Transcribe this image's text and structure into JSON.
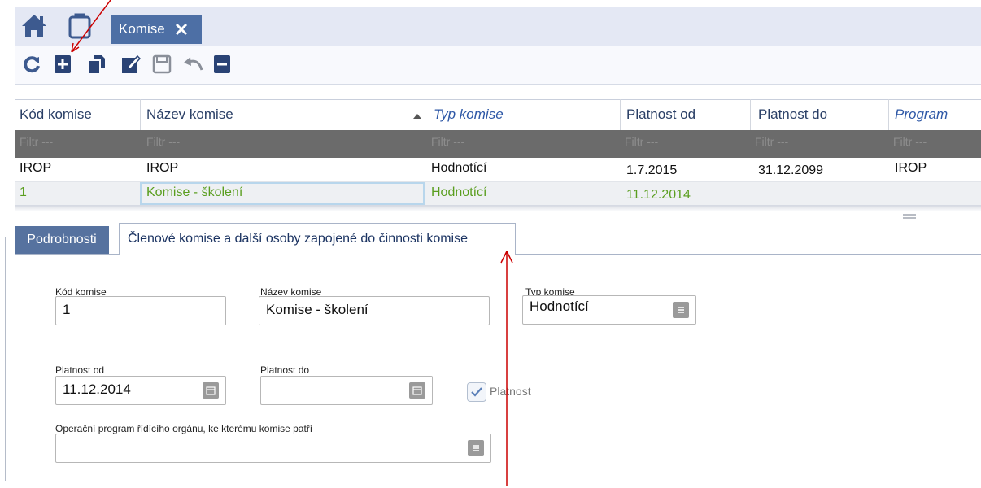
{
  "top_tab": {
    "label": "Komise"
  },
  "toolbar": {
    "icons": [
      "refresh-icon",
      "add-icon",
      "copy-icon",
      "edit-icon",
      "save-icon",
      "undo-icon",
      "delete-icon"
    ]
  },
  "grid": {
    "columns": [
      "Kód komise",
      "Název komise",
      "Typ komise",
      "Platnost od",
      "Platnost do",
      "Program"
    ],
    "filter_placeholder": "Filtr ---",
    "rows": [
      [
        "IROP",
        "IROP",
        "Hodnotící",
        "1.7.2015",
        "31.12.2099",
        "IROP"
      ],
      [
        "1",
        "Komise - školení",
        "Hodnotící",
        "11.12.2014",
        "",
        ""
      ]
    ],
    "selected_row_color": "#5a9e1f"
  },
  "detail_tabs": {
    "active": "Podrobnosti",
    "second": "Členové komise a další osoby zapojené do činnosti komise"
  },
  "form": {
    "kod_label": "Kód komise",
    "kod_value": "1",
    "nazev_label": "Název komise",
    "nazev_value": "Komise - školení",
    "typ_label": "Typ komise",
    "typ_value": "Hodnotící",
    "od_label": "Platnost od",
    "od_value": "11.12.2014",
    "do_label": "Platnost do",
    "do_value": "",
    "platnost_label": "Platnost",
    "program_label": "Operační program řídícího orgánu, ke kterému komise patří",
    "program_value": ""
  },
  "colors": {
    "tab_active": "#4d6fa5",
    "header_text": "#2a3f66",
    "annotation": "#cc0000"
  }
}
